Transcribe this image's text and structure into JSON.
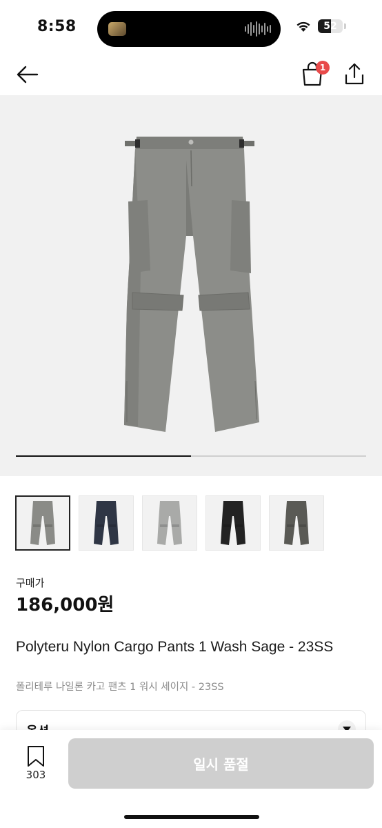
{
  "status_bar": {
    "time": "8:58",
    "battery": "52",
    "battery_level": 0.52
  },
  "header": {
    "cart_badge": "1"
  },
  "gallery": {
    "current_index": 1,
    "total_images": 2,
    "thumbnails": [
      {
        "color_name": "sage",
        "swatch": "#8a8b87"
      },
      {
        "color_name": "navy",
        "swatch": "#2f3645"
      },
      {
        "color_name": "light-grey",
        "swatch": "#a9aaa8"
      },
      {
        "color_name": "black",
        "swatch": "#232323"
      },
      {
        "color_name": "charcoal",
        "swatch": "#5a5a55"
      }
    ],
    "selected_thumbnail": 0
  },
  "product": {
    "price_label": "구매가",
    "price": "186,000원",
    "title_en": "Polyteru Nylon Cargo Pants 1 Wash Sage - 23SS",
    "title_ko": "폴리테루 나일론 카고 팬츠 1 워시 세이지 - 23SS"
  },
  "options": {
    "label": "옵션"
  },
  "bottom": {
    "wish_count": "303",
    "soldout_label": "일시 품절"
  },
  "colors": {
    "badge": "#e84a4a",
    "disabled_button": "#cfcfcf",
    "hero_bg": "#f1f1f1"
  }
}
